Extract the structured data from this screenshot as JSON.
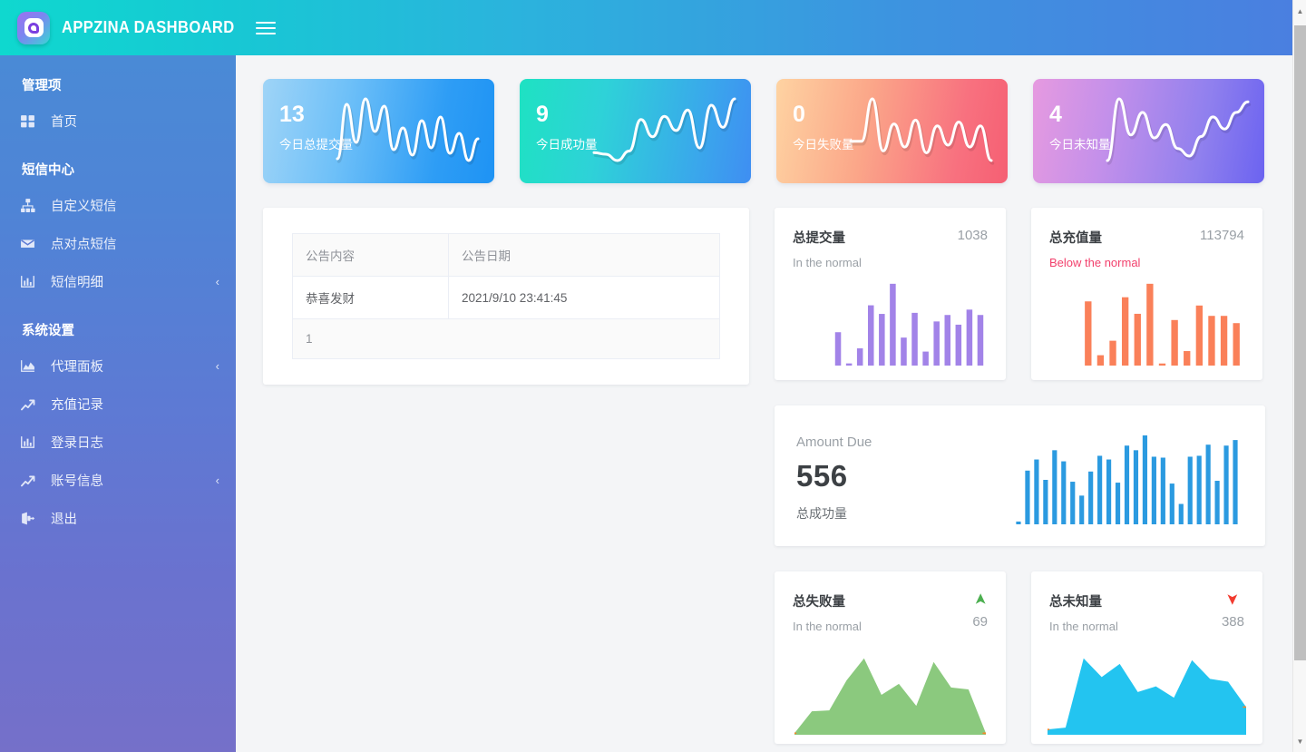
{
  "header": {
    "brand_title": "APPZINA DASHBOARD",
    "logo_icon": "appzina-logo-icon",
    "menu_icon": "hamburger-menu-icon",
    "gradient_from": "#0fd8cf",
    "gradient_to": "#4a7fe0"
  },
  "sidebar": {
    "gradient_from": "#4a8ad6",
    "gradient_to": "#7570c9",
    "sections": [
      {
        "title": "管理项",
        "items": [
          {
            "label": "首页",
            "icon": "grid-icon",
            "caret": ""
          }
        ]
      },
      {
        "title": "短信中心",
        "items": [
          {
            "label": "自定义短信",
            "icon": "sitemap-icon",
            "caret": ""
          },
          {
            "label": "点对点短信",
            "icon": "envelope-icon",
            "caret": ""
          },
          {
            "label": "短信明细",
            "icon": "bar-chart-icon",
            "caret": "‹"
          }
        ]
      },
      {
        "title": "系统设置",
        "items": [
          {
            "label": "代理面板",
            "icon": "area-chart-icon",
            "caret": "‹"
          },
          {
            "label": "充值记录",
            "icon": "line-chart-up-icon",
            "caret": ""
          },
          {
            "label": "登录日志",
            "icon": "bar-chart-icon",
            "caret": ""
          },
          {
            "label": "账号信息",
            "icon": "line-chart-up-icon",
            "caret": "‹"
          },
          {
            "label": "退出",
            "icon": "sign-out-icon",
            "caret": ""
          }
        ]
      }
    ]
  },
  "stats": [
    {
      "value": "13",
      "label": "今日总提交量",
      "theme": "sc-blue",
      "accent": "#1e93f4"
    },
    {
      "value": "9",
      "label": "今日成功量",
      "theme": "sc-teal",
      "accent": "#1ee2c2"
    },
    {
      "value": "0",
      "label": "今日失败量",
      "theme": "sc-orange",
      "accent": "#f55f73"
    },
    {
      "value": "4",
      "label": "今日未知量",
      "theme": "sc-purple",
      "accent": "#6b63f0"
    }
  ],
  "announcement": {
    "columns": [
      "公告内容",
      "公告日期"
    ],
    "rows": [
      {
        "content": "恭喜发财",
        "date": "2021/9/10 23:41:45"
      }
    ],
    "footer": "1"
  },
  "metrics": {
    "submitted": {
      "title": "总提交量",
      "value": "1038",
      "status": "In the normal",
      "status_type": "normal",
      "color": "#a283e8"
    },
    "recharge": {
      "title": "总充值量",
      "value": "113794",
      "status": "Below the normal",
      "status_type": "below",
      "color": "#fa8059"
    },
    "failed": {
      "title": "总失败量",
      "value": "69",
      "status": "In the normal",
      "trend": "up",
      "trend_icon": "arrow-up-icon",
      "color": "#8bc97e"
    },
    "unknown": {
      "title": "总未知量",
      "value": "388",
      "status": "In the normal",
      "trend": "down",
      "trend_icon": "arrow-down-icon",
      "color": "#23c4f0"
    }
  },
  "amount_due": {
    "label": "Amount Due",
    "value": "556",
    "sub_label": "总成功量",
    "color": "#2b9ae0"
  },
  "chart_data": [
    {
      "type": "line",
      "name": "今日总提交量-sparkline",
      "values": [
        12,
        72,
        30,
        78,
        42,
        70,
        22,
        46,
        16,
        54,
        24,
        58,
        18,
        40,
        10,
        34
      ]
    },
    {
      "type": "line",
      "name": "今日成功量-sparkline",
      "values": [
        24,
        22,
        14,
        26,
        66,
        44,
        70,
        52,
        78,
        30,
        84,
        56,
        92
      ]
    },
    {
      "type": "line",
      "name": "今日失败量-sparkline",
      "values": [
        40,
        40,
        84,
        30,
        58,
        34,
        62,
        28,
        56,
        36,
        60,
        34,
        56,
        20
      ]
    },
    {
      "type": "line",
      "name": "今日未知量-sparkline",
      "values": [
        8,
        90,
        42,
        72,
        38,
        56,
        24,
        14,
        40,
        66,
        50,
        72,
        86
      ]
    },
    {
      "type": "bar",
      "name": "总提交量",
      "color": "#a283e8",
      "values": [
        31,
        2,
        16,
        56,
        48,
        76,
        26,
        49,
        13,
        41,
        47,
        38,
        52,
        47
      ]
    },
    {
      "type": "bar",
      "name": "总充值量",
      "color": "#fa8059",
      "values": [
        62,
        10,
        24,
        66,
        50,
        79,
        2,
        44,
        14,
        58,
        48,
        48,
        41
      ]
    },
    {
      "type": "bar",
      "name": "总成功量 / Amount Due",
      "color": "#2b9ae0",
      "values": [
        3,
        58,
        70,
        48,
        80,
        68,
        46,
        31,
        57,
        74,
        70,
        45,
        85,
        80,
        96,
        73,
        72,
        44,
        22,
        73,
        74,
        86,
        47,
        85,
        91
      ]
    },
    {
      "type": "area",
      "name": "总失败量",
      "color": "#8bc97e",
      "x": [
        0,
        10,
        20,
        33,
        50,
        60,
        68,
        76,
        84,
        92,
        100
      ],
      "values": [
        0,
        24,
        25,
        58,
        82,
        42,
        54,
        30,
        78,
        50,
        48,
        0
      ]
    },
    {
      "type": "area",
      "name": "总未知量",
      "color": "#23c4f0",
      "x": [
        0,
        8,
        18,
        30,
        40,
        52,
        62,
        72,
        84,
        94,
        100
      ],
      "values": [
        4,
        6,
        80,
        60,
        74,
        44,
        50,
        38,
        78,
        58,
        55,
        28
      ]
    }
  ],
  "scrollbar": {
    "up_icon": "scroll-up-arrow-icon",
    "down_icon": "scroll-down-arrow-icon"
  }
}
